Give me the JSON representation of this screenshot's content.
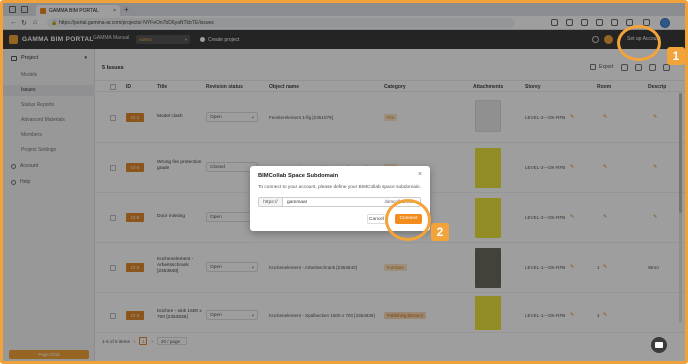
{
  "browser": {
    "tab_title": "GAMMA BIM PORTAL",
    "tab_close": "×",
    "new_tab": "+",
    "url": "https://portal.gamma-ar.com/projects/-NYFeOn7bD6yaNTkbTE/issues"
  },
  "header": {
    "brand": "GAMMA BIM PORTAL",
    "project_selector": "GAMMA Manual",
    "role_badge": "Admin",
    "create_project": "Create project",
    "setup_account": "Set up Account"
  },
  "sidebar": {
    "project_label": "Project",
    "items": [
      {
        "label": "Models"
      },
      {
        "label": "Issues"
      },
      {
        "label": "Status Reports"
      },
      {
        "label": "Advanced Materials"
      },
      {
        "label": "Members"
      },
      {
        "label": "Project Settings"
      }
    ],
    "account": "Account",
    "help": "Help",
    "footer": "Page Chat"
  },
  "main": {
    "issues_count": "5 Issues",
    "export": "Export",
    "columns": [
      "ID",
      "Title",
      "Revision status",
      "Object name",
      "Category",
      "Attachments",
      "Storey",
      "Room",
      "Descrip"
    ],
    "rows": [
      {
        "id": "CI-1",
        "title": "Model clash",
        "status": "Open",
        "object": "Fensterelement 1-flg [2351079]",
        "category": "Fire",
        "storey": "LEVEL-2---OK-RFB",
        "room": "",
        "desc": ""
      },
      {
        "id": "CI-4",
        "title": "Wrong fire protection grade",
        "status": "Closed",
        "object": "T30-RS-1 - Rahmentür Richtung/ T30 [2336453]",
        "category": "Fire",
        "storey": "LEVEL-2---OK-RFB",
        "room": "",
        "desc": ""
      },
      {
        "id": "CI-5",
        "title": "Door missing",
        "status": "Open",
        "object": "",
        "category": "",
        "storey": "LEVEL-2---OK-RFB",
        "room": "",
        "desc": ""
      },
      {
        "id": "CI-2",
        "title": "Küchenelement - Arbeitsschrank [2353640]",
        "status": "Open",
        "object": "Küchenelement - Arbeitsschrank [2353640]",
        "category": "Furniture",
        "storey": "LEVEL-1---OK-RFB",
        "room": "1",
        "desc": "Wron"
      },
      {
        "id": "CI-3",
        "title": "Küchen - sink 1500 x 700 [2353836]",
        "status": "Open",
        "object": "Küchenelement - Spülbecken 1500 x 700 [2353836]",
        "category": "Publishing Element",
        "storey": "LEVEL-1---OK-RFB",
        "room": "4",
        "desc": ""
      }
    ],
    "pager_range": "1-5 of 5 items",
    "page": "1",
    "per_page": "20 / page"
  },
  "modal": {
    "title": "BIMCollab Space Subdomain",
    "close": "×",
    "text": "To connect to your account, please define your BIMCollab space subdomain.",
    "prefix": "https://",
    "value": "gammaar",
    "suffix": ".bimcollab.com",
    "cancel": "Cancel",
    "connect": "Connect"
  },
  "annotations": [
    "1",
    "2"
  ],
  "colors": {
    "accent": "#f2a33a",
    "header_bg": "#3b3b3b",
    "id_tag": "#e08a2e"
  }
}
